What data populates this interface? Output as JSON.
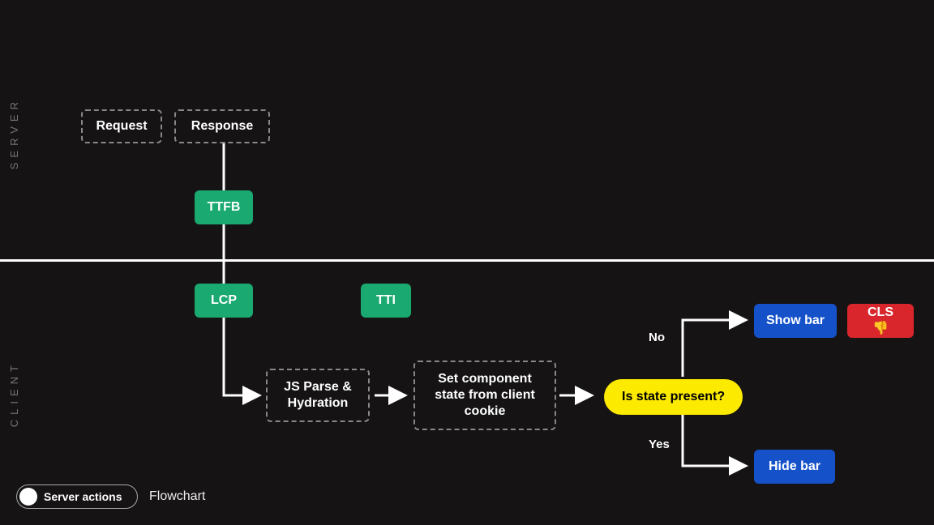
{
  "labels": {
    "server": "SERVER",
    "client": "CLIENT"
  },
  "nodes": {
    "request": "Request",
    "response": "Response",
    "ttfb": "TTFB",
    "lcp": "LCP",
    "tti": "TTI",
    "js": "JS Parse & Hydration",
    "set_state": "Set component state from client cookie",
    "decision": "Is state present?",
    "no": "No",
    "yes": "Yes",
    "show_bar": "Show bar",
    "hide_bar": "Hide bar",
    "cls": "CLS 👎"
  },
  "footer": {
    "toggle_label": "Server actions",
    "caption": "Flowchart"
  }
}
